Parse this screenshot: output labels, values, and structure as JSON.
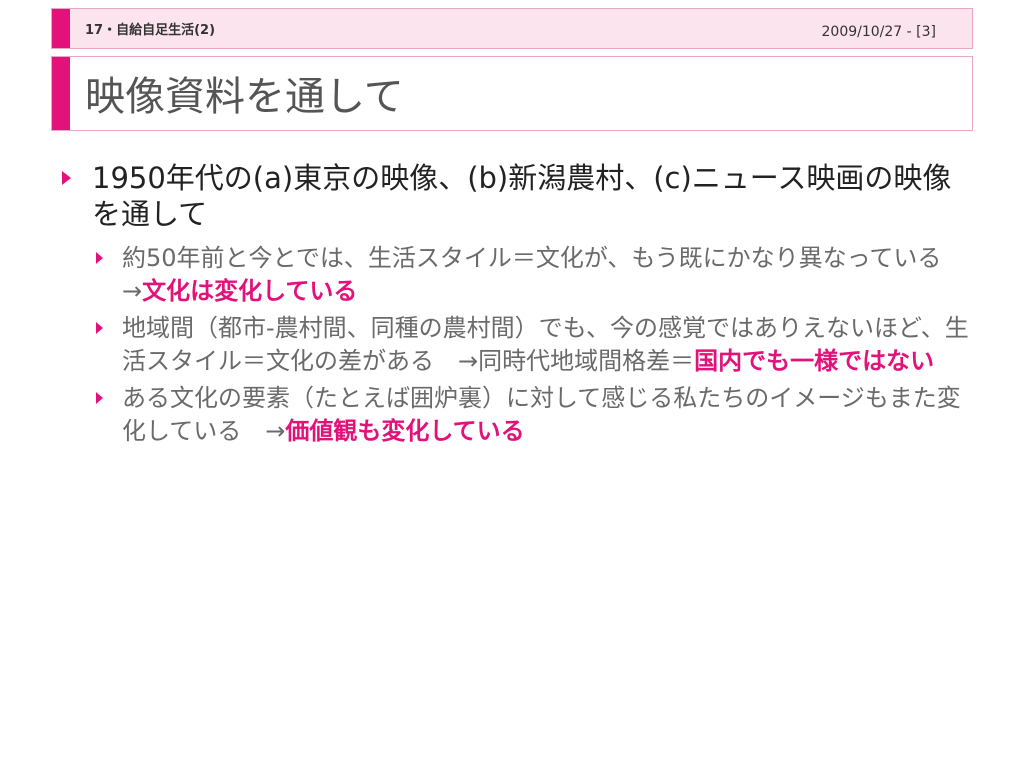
{
  "header": {
    "section": "17・自給自足生活(2)",
    "date_page": "2009/10/27 - [3]"
  },
  "title": "映像資料を通して",
  "colors": {
    "accent": "#e2127a",
    "header_bg": "#fbe4ee",
    "border": "#e8a8c4"
  },
  "content": {
    "main_bullet": "1950年代の(a)東京の映像、(b)新潟農村、(c)ニュース映画の映像を通して",
    "sub_bullets": [
      {
        "text": "約50年前と今とでは、生活スタイル＝文化が、もう既にかなり異なっている　→",
        "highlight": "文化は変化している"
      },
      {
        "text": "地域間（都市-農村間、同種の農村間）でも、今の感覚ではありえないほど、生活スタイル＝文化の差がある　→同時代地域間格差＝",
        "highlight": "国内でも一様ではない"
      },
      {
        "text": "ある文化の要素（たとえば囲炉裏）に対して感じる私たちのイメージもまた変化している　→",
        "highlight": "価値観も変化している"
      }
    ]
  }
}
